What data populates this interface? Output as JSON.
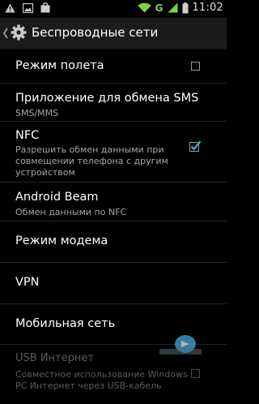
{
  "status_bar": {
    "time": "11:02",
    "network_type": "G",
    "left_icons": [
      "warning-icon",
      "image-icon",
      "bag-icon"
    ],
    "right_icons": [
      "wifi-icon",
      "signal-icon",
      "battery-icon"
    ]
  },
  "action_bar": {
    "title": "Беспроводные сети",
    "up_icon": "chevron-left-icon",
    "app_icon": "settings-gear-icon"
  },
  "items": [
    {
      "title": "Режим полета",
      "summary": "",
      "checkbox": "unchecked",
      "enabled": true
    },
    {
      "title": "Приложение для обмена SMS",
      "summary": "SMS/MMS",
      "enabled": true
    },
    {
      "title": "NFC",
      "summary": "Разрешить обмен данными при совмещении телефона с другим устройством",
      "checkbox": "checked",
      "enabled": true
    },
    {
      "title": "Android Beam",
      "summary": "Обмен данными по NFC",
      "enabled": true
    },
    {
      "title": "Режим модема",
      "summary": "",
      "enabled": true
    },
    {
      "title": "VPN",
      "summary": "",
      "enabled": true
    },
    {
      "title": "Мобильная сеть",
      "summary": "",
      "enabled": true
    },
    {
      "title": "USB Интернет",
      "summary": "Совместное использование Windows PC Интернет через USB-кабель",
      "checkbox": "unchecked",
      "enabled": false
    }
  ],
  "colors": {
    "accent": "#33b5e5",
    "background": "#000000",
    "action_bar": "#1b1b1b",
    "summary_text": "#a6a6a6",
    "disabled_text": "#5b5b5b"
  }
}
